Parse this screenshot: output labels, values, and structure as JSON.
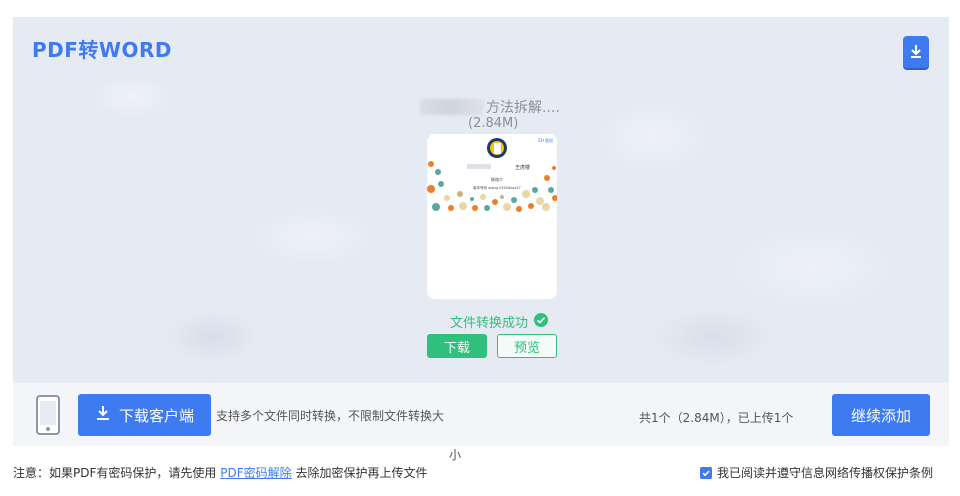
{
  "header": {
    "title": "PDF转WORD"
  },
  "file": {
    "name_suffix": "方法拆解....",
    "size": "(2.84M)",
    "preview": {
      "top_tag": "ZH 版权",
      "name_line": "王虎楼",
      "line2": "联络介",
      "line3": "版本号码   xiang:13504xxx27"
    },
    "status": "文件转换成功"
  },
  "actions": {
    "download": "下载",
    "preview": "预览"
  },
  "bottom": {
    "client_button": "下载客户端",
    "support_text": "支持多个文件同时转换，不限制文件转换大",
    "support_text_wrap": "小",
    "count_text": "共1个（2.84M），已上传1个",
    "continue_button": "继续添加"
  },
  "footer": {
    "note_prefix": "注意：如果PDF有密码保护，请先使用",
    "note_link": "PDF密码解除",
    "note_suffix": "去除加密保护再上传文件",
    "agree_text": "我已阅读并遵守信息网络传播权保护条例"
  },
  "colors": {
    "accent": "#3f7bf0",
    "success": "#2ec07c"
  },
  "icons": [
    "download-badge-icon",
    "check-circle-icon",
    "phone-icon",
    "download-arrow-icon",
    "checkbox-checked-icon"
  ]
}
